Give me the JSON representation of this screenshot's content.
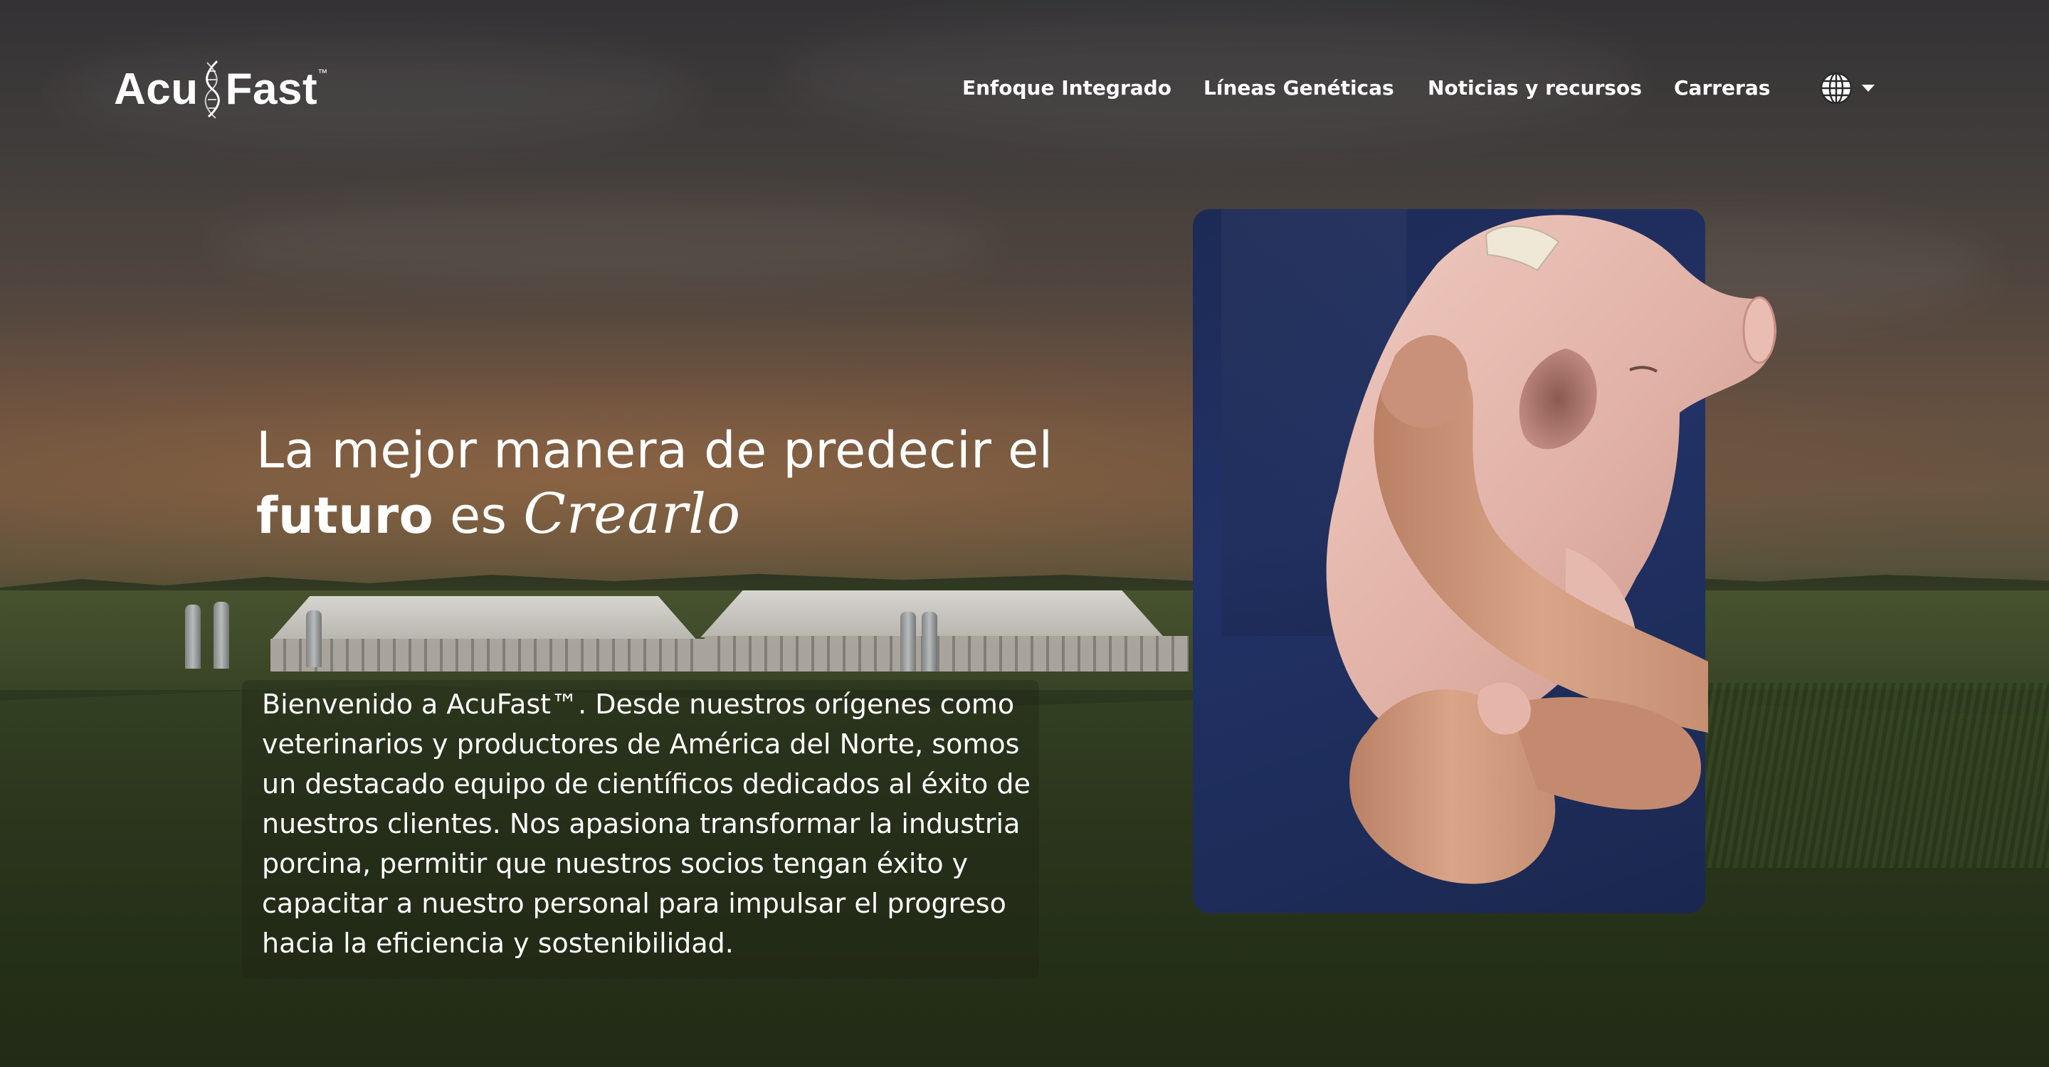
{
  "brand": {
    "logo_left": "Acu",
    "logo_right": "Fast",
    "logo_mark": "™"
  },
  "nav": {
    "items": [
      {
        "label": "Enfoque Integrado"
      },
      {
        "label": "Líneas Genéticas"
      },
      {
        "label": "Noticias y recursos"
      },
      {
        "label": "Carreras"
      }
    ],
    "language_icon": "globe-icon"
  },
  "hero": {
    "title_line1": "La mejor manera de predecir el",
    "title_bold": "futuro",
    "title_mid": " es ",
    "title_script": "Crearlo",
    "intro": "Bienvenido a AcuFast™. Desde nuestros orígenes como veterinarios y productores de América del Norte, somos un destacado equipo de científicos dedicados al éxito de nuestros clientes. Nos apasiona transformar la industria porcina, permitir que nuestros socios tengan éxito y capacitar a nuestro personal para impulsar el progreso hacia la eficiencia y sostenibilidad."
  },
  "colors": {
    "text": "#ffffff",
    "card_blue": "#1f2e5e",
    "pig_pink": "#e2b6ad",
    "skin": "#d79f82"
  }
}
